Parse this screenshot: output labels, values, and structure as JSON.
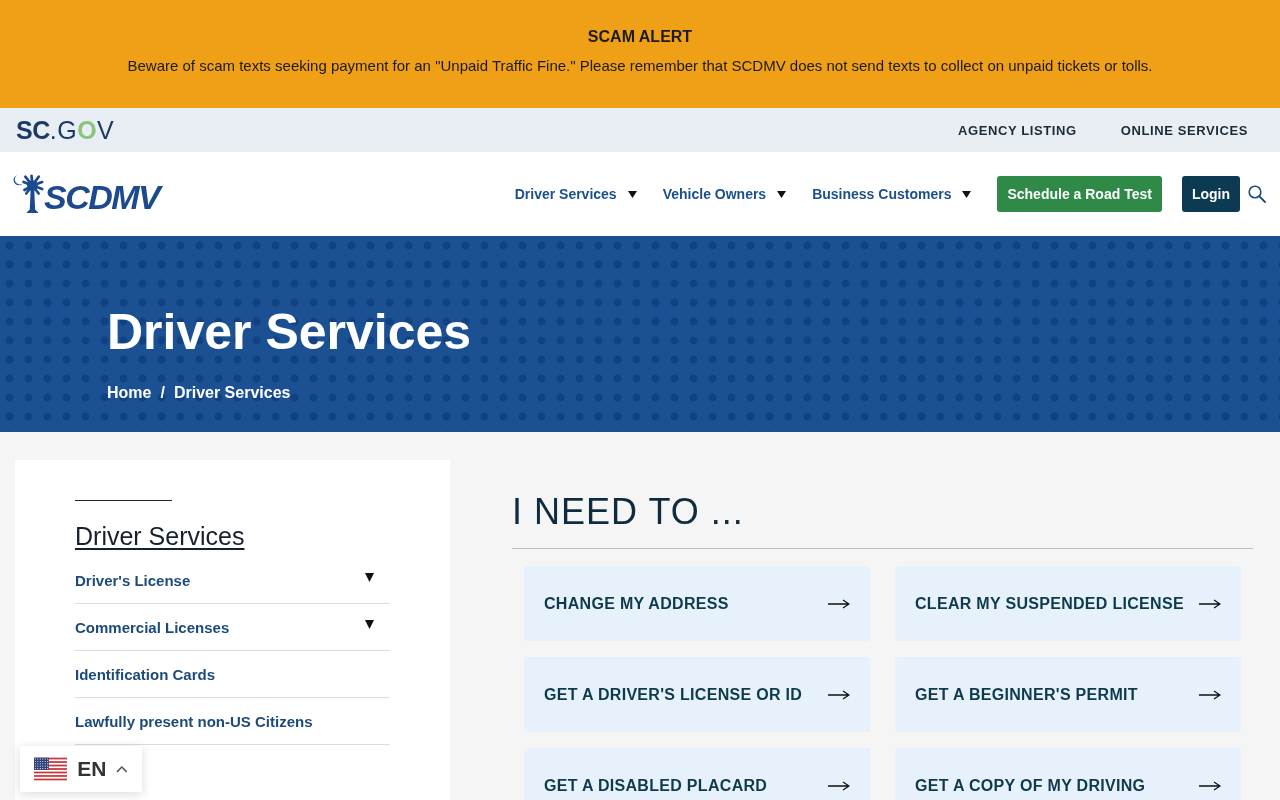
{
  "alert": {
    "title": "SCAM ALERT",
    "message": "Beware of scam texts seeking payment for an \"Unpaid Traffic Fine.\" Please remember that SCDMV does not send texts to collect on unpaid tickets or tolls."
  },
  "portal_bar": {
    "logo": [
      {
        "text": "SC",
        "kind": "strong"
      },
      {
        "text": ".G",
        "kind": "plain"
      },
      {
        "text": "O",
        "kind": "accent"
      },
      {
        "text": "V",
        "kind": "plain"
      }
    ],
    "links": [
      "AGENCY LISTING",
      "ONLINE SERVICES"
    ]
  },
  "header": {
    "logo": "SCDMV",
    "nav": [
      {
        "label": "Driver Services",
        "dropdown": true
      },
      {
        "label": "Vehicle Owners",
        "dropdown": true
      },
      {
        "label": "Business Customers",
        "dropdown": true
      }
    ],
    "actions": [
      {
        "label": "Schedule a Road Test",
        "kind": "primary"
      },
      {
        "label": "Login",
        "kind": "dark"
      }
    ]
  },
  "hero": {
    "title": "Driver Services",
    "breadcrumb": [
      "Home",
      "Driver Services"
    ],
    "separator": "/"
  },
  "sidebar": {
    "heading": "Driver Services",
    "items": [
      {
        "label": "Driver's License",
        "expandable": true
      },
      {
        "label": "Commercial Licenses",
        "expandable": true
      },
      {
        "label": "Identification Cards",
        "expandable": false
      },
      {
        "label": "Lawfully present non-US Citizens",
        "expandable": false
      }
    ]
  },
  "tasks": {
    "heading": "I NEED TO ...",
    "cards": [
      "CHANGE MY ADDRESS",
      "CLEAR MY SUSPENDED LICENSE",
      "GET A DRIVER'S LICENSE OR ID",
      "GET A BEGINNER'S PERMIT",
      "GET A DISABLED PLACARD",
      "GET A COPY OF MY DRIVING"
    ]
  },
  "language_selector": {
    "code": "EN"
  }
}
